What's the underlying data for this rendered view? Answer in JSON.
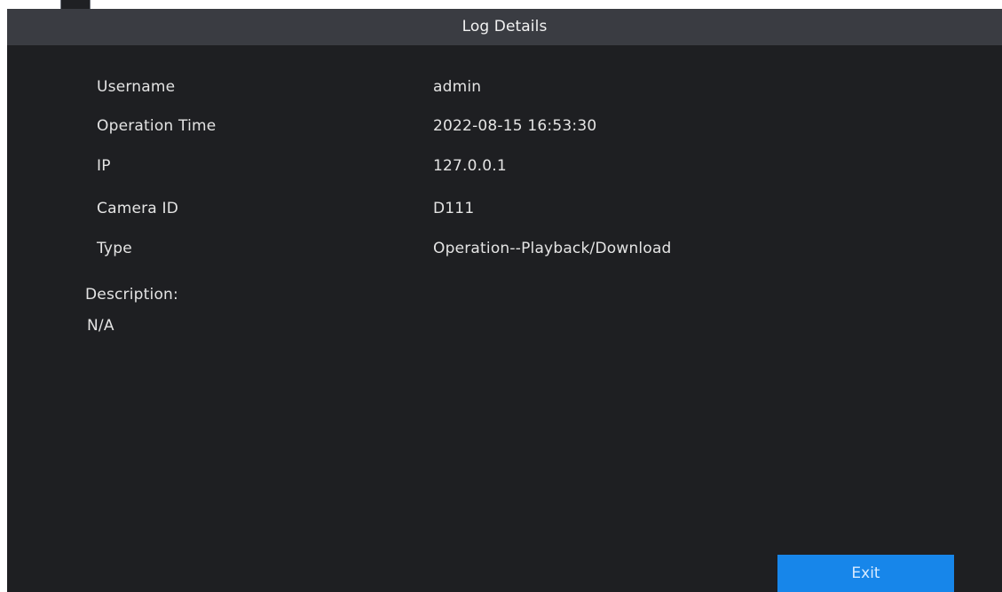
{
  "dialog": {
    "title": "Log Details",
    "rows": [
      {
        "label": "Username",
        "value": "admin"
      },
      {
        "label": "Operation Time",
        "value": "2022-08-15 16:53:30"
      },
      {
        "label": "IP",
        "value": "127.0.0.1"
      },
      {
        "label": "Camera ID",
        "value": "D111"
      },
      {
        "label": "Type",
        "value": "Operation--Playback/Download"
      }
    ],
    "description": {
      "label": "Description:",
      "value": "N/A"
    },
    "exit_label": "Exit"
  },
  "colors": {
    "panel_bg": "#1e1f22",
    "titlebar_bg": "#3a3c42",
    "accent": "#1786ea"
  }
}
